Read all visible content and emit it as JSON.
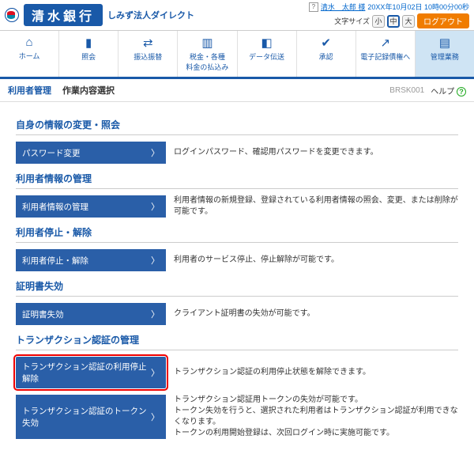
{
  "header": {
    "bank_name": "清水銀行",
    "service_name": "しみず法人ダイレクト",
    "user_icon": "?",
    "user_name": "清水　太郎 様",
    "timestamp": "20XX年10月02日 10時00分00秒",
    "fontsize_label": "文字サイズ",
    "size_small": "小",
    "size_medium": "中",
    "size_large": "大",
    "logout": "ログアウト"
  },
  "nav": {
    "items": [
      {
        "icon": "⌂",
        "label": "ホーム"
      },
      {
        "icon": "▮",
        "label": "照会"
      },
      {
        "icon": "⇄",
        "label": "振込振替"
      },
      {
        "icon": "▥",
        "label": "税金・各種\n料金の払込み"
      },
      {
        "icon": "◧",
        "label": "データ伝送"
      },
      {
        "icon": "✔",
        "label": "承認"
      },
      {
        "icon": "↗",
        "label": "電子記録債権へ"
      },
      {
        "icon": "▤",
        "label": "管理業務"
      }
    ]
  },
  "subheader": {
    "bc_active": "利用者管理",
    "bc_rest": "作業内容選択",
    "code": "BRSK001",
    "help": "ヘルプ",
    "help_icon": "?"
  },
  "sections": [
    {
      "title": "自身の情報の変更・照会",
      "rows": [
        {
          "btn": "パスワード変更",
          "desc": "ログインパスワード、確認用パスワードを変更できます。"
        }
      ]
    },
    {
      "title": "利用者情報の管理",
      "rows": [
        {
          "btn": "利用者情報の管理",
          "desc": "利用者情報の新規登録、登録されている利用者情報の照会、変更、または削除が可能です。"
        }
      ]
    },
    {
      "title": "利用者停止・解除",
      "rows": [
        {
          "btn": "利用者停止・解除",
          "desc": "利用者のサービス停止、停止解除が可能です。"
        }
      ]
    },
    {
      "title": "証明書失効",
      "rows": [
        {
          "btn": "証明書失効",
          "desc": "クライアント証明書の失効が可能です。"
        }
      ]
    },
    {
      "title": "トランザクション認証の管理",
      "rows": [
        {
          "btn": "トランザクション認証の利用停止解除",
          "desc": "トランザクション認証の利用停止状態を解除できます。",
          "highlight": true
        },
        {
          "btn": "トランザクション認証のトークン失効",
          "desc": "トランザクション認証用トークンの失効が可能です。\nトークン失効を行うと、選択された利用者はトランザクション認証が利用できなくなります。\nトークンの利用開始登録は、次回ログイン時に実施可能です。"
        }
      ]
    }
  ]
}
